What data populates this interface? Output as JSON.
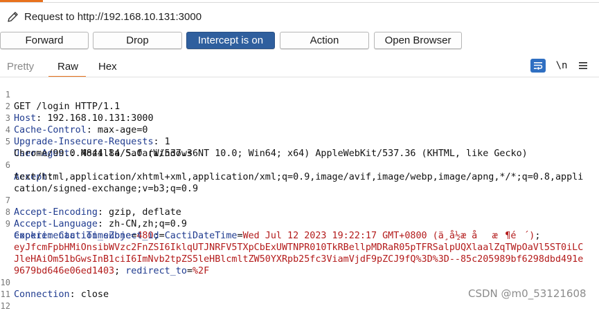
{
  "title": {
    "text": "Request to http://192.168.10.131:3000",
    "icon": "pencil-icon"
  },
  "buttons": {
    "forward": "Forward",
    "drop": "Drop",
    "intercept": "Intercept is on",
    "action": "Action",
    "open_browser": "Open Browser"
  },
  "tabs": {
    "pretty": "Pretty",
    "raw": "Raw",
    "hex": "Hex",
    "selected": "Raw"
  },
  "toolbar": {
    "wrap_icon": "text-wrap-icon",
    "newline": "\\n",
    "menu_icon": "menu-icon"
  },
  "editor": {
    "line_numbers": [
      "1",
      "2",
      "3",
      "4",
      "5",
      "6",
      "7",
      "8",
      "9",
      "10",
      "11",
      "12"
    ],
    "l1": "GET /login HTTP/1.1",
    "l2": {
      "name": "Host",
      "value": " 192.168.10.131:3000"
    },
    "l3": {
      "name": "Cache-Control",
      "value": " max-age=0"
    },
    "l4": {
      "name": "Upgrade-Insecure-Requests",
      "value": " 1"
    },
    "l5": {
      "name": "User-Agent",
      "value": " Mozilla/5.0 (Windows NT 10.0; Win64; x64) AppleWebKit/537.36 (KHTML, like Gecko)",
      "cont": "Chrome/99.0.4844.84 Safari/537.36"
    },
    "l6": {
      "name": "Accept",
      "cont1": "text/html,application/xhtml+xml,application/xml;q=0.9,image/avif,image/webp,image/apng,*/*;q=0.8,appli",
      "cont2": "cation/signed-exchange;v=b3;q=0.9"
    },
    "l7": {
      "name": "Accept-Encoding",
      "value": " gzip, deflate"
    },
    "l8": {
      "name": "Accept-Language",
      "value": " zh-CN,zh;q=0.9"
    },
    "l9": {
      "name": "Cookie",
      "c1_name": "CactiTimeZone",
      "c1_value": "480",
      "c2_name": "CactiDateTime",
      "c2_value": "Wed Jul 12 2023 19:22:17 GMT+0800 (ä¸­å½æ åæ¶é´)",
      "c3_name": "experimentation_subject_id",
      "c3_value_1": "eyJfcmFpbHMiOnsibWVzc2FnZSI6IklqUTJNRFV5TXpCbExUWTNPR010TkRBellpMDRaR05pTFRSalpUQXlaalZqTWpOaVl5ST0iLC",
      "c3_value_2": "JleHAiOm51bGwsInB1ciI6ImNvb2tpZS5leHBlcmltZW50YXRpb25fc3ViamVjdF9pZCJ9fQ%3D%3D--85c205989bf6298dbd491e",
      "c3_value_3": "9679bd646e06ed1403",
      "c4_name": "redirect_to",
      "c4_value": "%2F"
    },
    "l10": {
      "name": "Connection",
      "value": " close"
    }
  },
  "watermark": "CSDN @m0_53121608",
  "colors": {
    "accent": "#e8711c",
    "intercept_button": "#2f5f9e",
    "header_name": "#1f3b8f",
    "cookie_value": "#b31a1a"
  }
}
